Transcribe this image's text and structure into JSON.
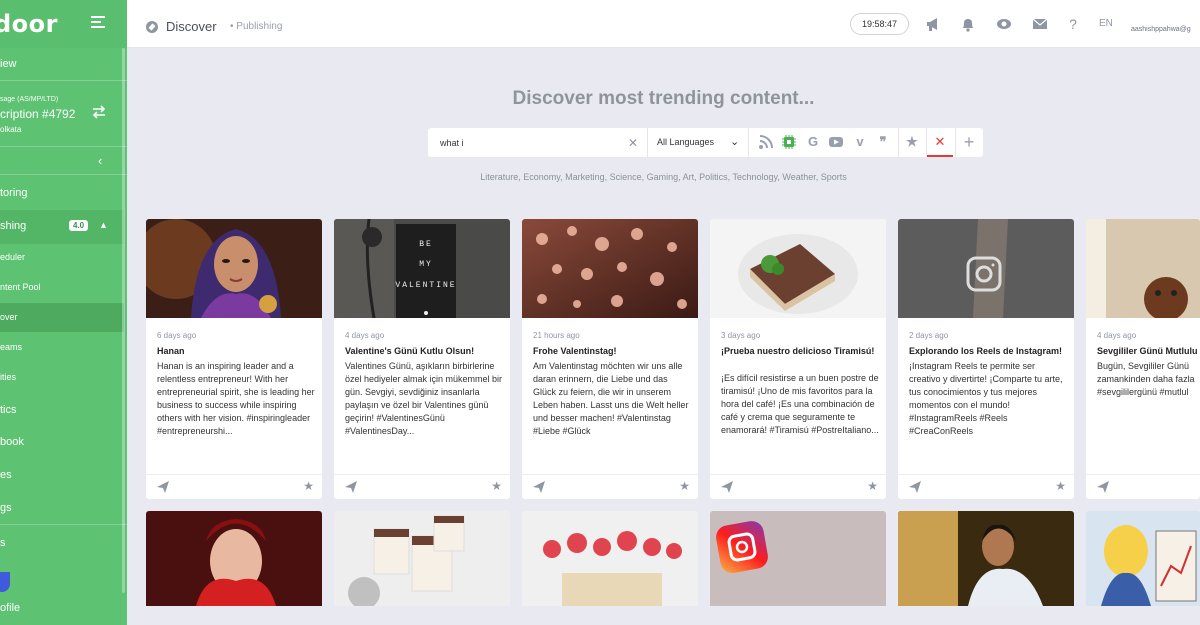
{
  "sidebar": {
    "logo": "door",
    "items": {
      "overview": "iew",
      "account_line1": "sage (AS/MP/LTD)",
      "account_line2": "cription #4792",
      "account_line3": "olkata",
      "monitoring": "toring",
      "publishing": "shing",
      "publishing_badge": "4.0",
      "scheduler": "eduler",
      "content_pool": "ntent Pool",
      "discover": "over",
      "streams": "eams",
      "activities": "ities",
      "analytics": "tics",
      "inbox": "book",
      "files": "es",
      "settings": "gs",
      "misc": "s",
      "profile": "ofile"
    }
  },
  "header": {
    "title": "Discover",
    "breadcrumb": "• Publishing",
    "clock": "19:58:47",
    "language": "EN",
    "user": "aashishppahwa@g"
  },
  "main": {
    "headline": "Discover most trending content...",
    "search_value": "what i",
    "language_filter": "All Languages",
    "categories": "Literature, Economy, Marketing, Science, Gaming, Art, Politics, Technology, Weather, Sports"
  },
  "cards": [
    {
      "age": "6 days ago",
      "title": "Hanan",
      "body": "Hanan is an inspiring leader and a relentless entrepreneur! With her entrepreneurial spirit, she is leading her business to success while inspiring others with her vision. #inspiringleader #entrepreneurshi..."
    },
    {
      "age": "4 days ago",
      "title": "Valentine's Günü Kutlu Olsun!",
      "body": "Valentines Günü, aşıkların birbirlerine özel hediyeler almak için mükemmel bir gün. Sevgiyi, sevdiğiniz insanlarla paylaşın ve özel bir Valentines günü geçirin! #ValentinesGünü #ValentinesDay..."
    },
    {
      "age": "21 hours ago",
      "title": "Frohe Valentinstag!",
      "body": "Am Valentinstag möchten wir uns alle daran erinnern, die Liebe und das Glück zu feiern, die wir in unserem Leben haben. Lasst uns die Welt heller und besser machen! #Valentinstag #Liebe #Glück"
    },
    {
      "age": "3 days ago",
      "title": "¡Prueba nuestro delicioso Tiramisú!",
      "body": "¡Es difícil resistirse a un buen postre de tiramisú! ¡Uno de mis favoritos para la hora del café! ¡Es una combinación de café y crema que seguramente te enamorará! #Tiramisú #PostreItaliano..."
    },
    {
      "age": "2 days ago",
      "title": "Explorando los Reels de Instagram!",
      "body": "¡Instagram Reels te permite ser creativo y divertirte! ¡Comparte tu arte, tus conocimientos y tus mejores momentos con el mundo! #InstagramReels #Reels #CreaConReels"
    },
    {
      "age": "4 days ago",
      "title": "Sevgililer Günü Mutlulu",
      "body": "Bugün, Sevgililer Günü zamankinden daha fazla #sevgililergünü #mutlul"
    }
  ],
  "image_text": {
    "valentine_sign": [
      "BE",
      "MY",
      "VALENTINE"
    ]
  },
  "colors": {
    "sidebar": "#5dc271",
    "background": "#e9eaf1",
    "accent_red": "#e53935",
    "icon_gray": "#8f96a3"
  }
}
